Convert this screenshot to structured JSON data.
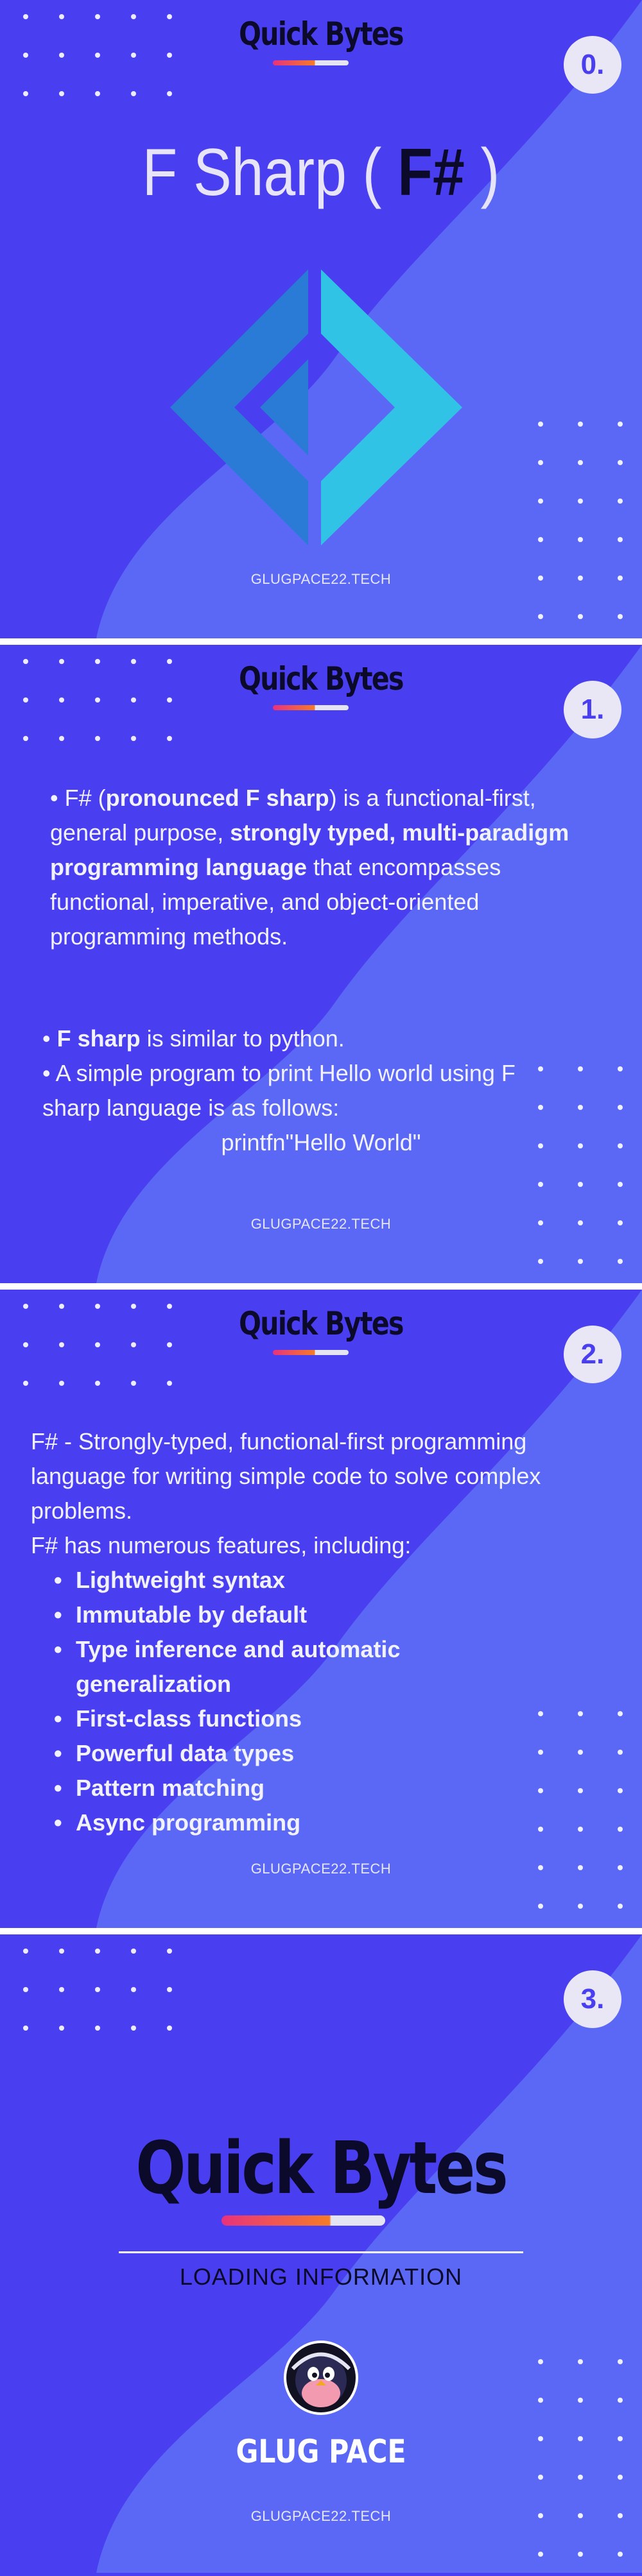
{
  "brand": "Quick Bytes",
  "footer": "GLUGPACE22.TECH",
  "colors": {
    "background": "#4a3ff0",
    "wave": "#5b68f5",
    "logo_left": "#2a7bd6",
    "logo_right": "#31c3e6",
    "accent_pink": "#e8327d",
    "accent_orange": "#f57b27"
  },
  "slides": [
    {
      "number": "0.",
      "title_plain": "F Sharp ( ",
      "title_bold": "F#",
      "title_end": " )",
      "logo_icon": "fsharp-logo-icon"
    },
    {
      "number": "1.",
      "p1_a": "• F# (",
      "p1_b": "pronounced F sharp",
      "p1_c": ") is a functional-first, general purpose, ",
      "p1_d": "strongly typed, multi-paradigm programming language",
      "p1_e": " that encompasses functional, imperative, and object-oriented programming methods.",
      "p2_a": "• ",
      "p2_b": "F sharp",
      "p2_c": " is similar to python.",
      "p3": "• A simple program to print Hello world using F sharp language is as follows:",
      "code": "printfn\"Hello World\""
    },
    {
      "number": "2.",
      "intro": "F# - Strongly-typed, functional-first programming language for writing simple code to solve complex problems.",
      "features_intro": "F# has numerous features, including:",
      "features": [
        "Lightweight syntax",
        "Immutable by default",
        "Type inference and automatic generalization",
        "First-class functions",
        "Powerful data types",
        "Pattern matching",
        "Async programming"
      ]
    },
    {
      "number": "3.",
      "big_title": "Quick Bytes",
      "subtitle": "LOADING INFORMATION",
      "org": "GLUG PACE",
      "logo_icon": "glug-penguin-logo-icon"
    }
  ]
}
